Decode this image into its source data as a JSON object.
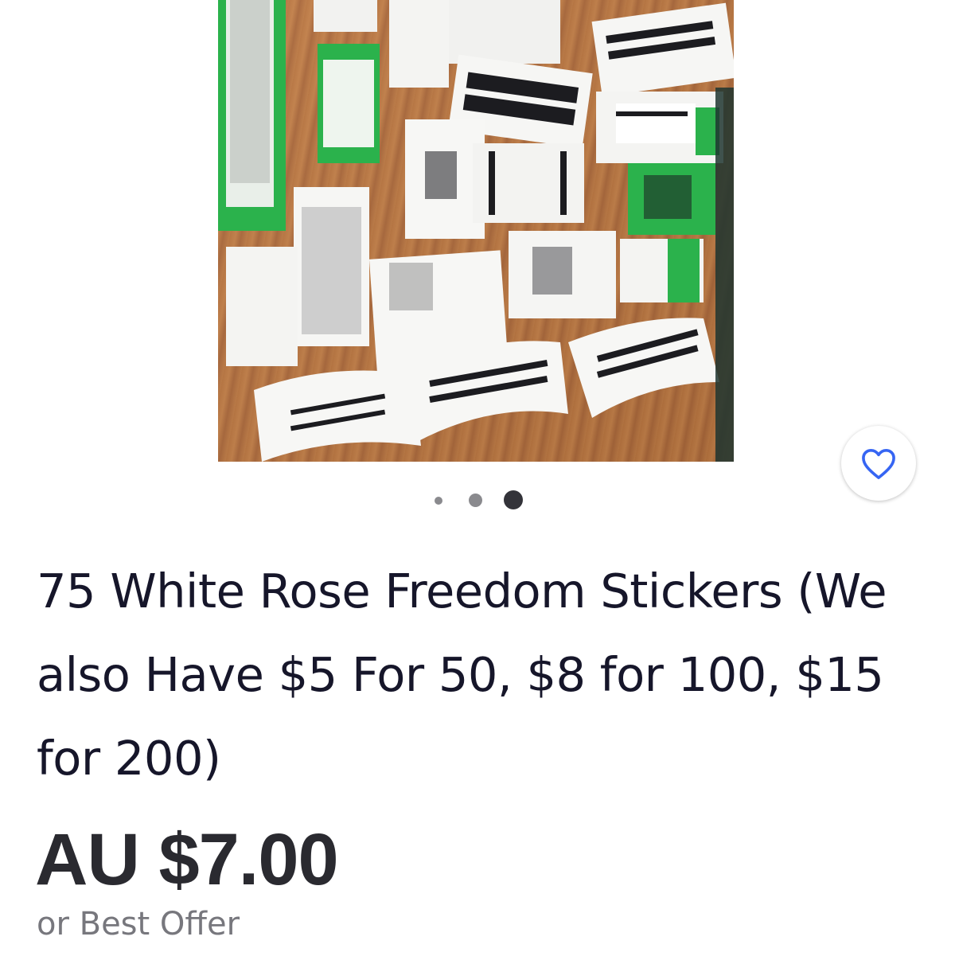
{
  "listing": {
    "title": "75 White Rose Freedom Stickers (We also Have $5 For 50, $8 for 100, $15 for 200)",
    "price": "AU $7.00",
    "price_note": "or Best Offer",
    "image_carousel": {
      "total": 3,
      "active_index": 2
    },
    "image_alt": "Stacks of printed stickers spread on a wooden table"
  },
  "icons": {
    "favorite": "heart-outline-icon"
  },
  "colors": {
    "accent": "#3665f3",
    "text": "#16162a",
    "secondary": "#77777d",
    "sticker_green": "#2bb24c"
  }
}
